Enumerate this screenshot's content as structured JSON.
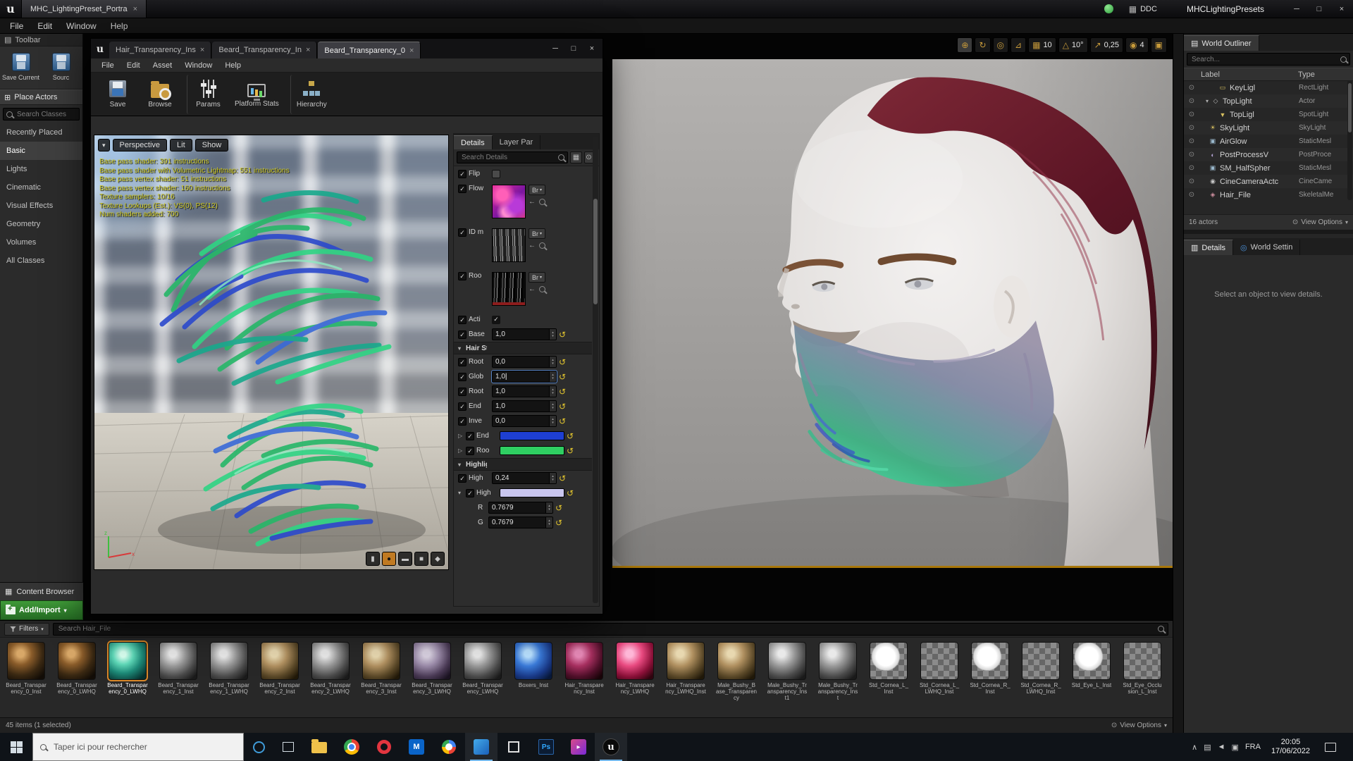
{
  "titlebar": {
    "tab_label": "MHC_LightingPreset_Portra",
    "ddc_label": "DDC",
    "preset_label": "MHCLightingPresets"
  },
  "menubar": {
    "items": [
      {
        "label": "File"
      },
      {
        "label": "Edit"
      },
      {
        "label": "Window"
      },
      {
        "label": "Help"
      }
    ]
  },
  "left_panel": {
    "toolbar_title": "Toolbar",
    "buttons": [
      {
        "label": "Save Current"
      },
      {
        "label": "Sourc"
      }
    ],
    "place_actors_title": "Place Actors",
    "search_placeholder": "Search Classes",
    "categories": [
      {
        "label": "Recently Placed"
      },
      {
        "label": "Basic",
        "selected": true
      },
      {
        "label": "Lights"
      },
      {
        "label": "Cinematic"
      },
      {
        "label": "Visual Effects"
      },
      {
        "label": "Geometry"
      },
      {
        "label": "Volumes"
      },
      {
        "label": "All Classes"
      }
    ],
    "content_browser_tab": "Content Browser",
    "add_import_label": "Add/Import"
  },
  "material_editor": {
    "tabs": [
      {
        "label": "Hair_Transparency_Ins"
      },
      {
        "label": "Beard_Transparency_In"
      },
      {
        "label": "Beard_Transparency_0",
        "active": true
      }
    ],
    "menu": [
      {
        "label": "File"
      },
      {
        "label": "Edit"
      },
      {
        "label": "Asset"
      },
      {
        "label": "Window"
      },
      {
        "label": "Help"
      }
    ],
    "toolbar": [
      {
        "label": "Save",
        "icon": "ic-save"
      },
      {
        "label": "Browse",
        "icon": "ic-browse"
      },
      {
        "label": "Params",
        "icon": "ic-params",
        "sep": true
      },
      {
        "label": "Platform Stats",
        "icon": "ic-stats"
      },
      {
        "label": "Hierarchy",
        "icon": "ic-hier",
        "sep": true
      }
    ],
    "viewport": {
      "perspective": "Perspective",
      "lit": "Lit",
      "show": "Show",
      "stats": [
        {
          "line": "Base pass shader: 391 instructions"
        },
        {
          "line": "Base pass shader with Volumetric Lightmap: 551 instructions"
        },
        {
          "line": "Base pass vertex shader: 51 instructions"
        },
        {
          "line": "Base pass vertex shader: 160 instructions"
        },
        {
          "line": "Texture samplers: 10/16"
        },
        {
          "line": "Texture Lookups (Est.): VS(0), PS(12)"
        },
        {
          "line": "Num shaders added: 700"
        }
      ]
    },
    "details": {
      "tab_details": "Details",
      "tab_layer": "Layer Par",
      "search_placeholder": "Search Details",
      "params": [
        {
          "kind": "k-check",
          "label": "Flip"
        },
        {
          "kind": "k-texture",
          "label": "Flow",
          "tex": "tex-flow",
          "btn": "Br"
        },
        {
          "kind": "k-texture",
          "label": "ID m",
          "tex": "tex-id",
          "btn": "Br"
        },
        {
          "kind": "k-texture",
          "label": "Roo",
          "tex": "tex-root",
          "btn": "Br"
        },
        {
          "kind": "k-checkval",
          "label": "Acti"
        },
        {
          "kind": "k-number",
          "label": "Base",
          "value": "1,0"
        },
        {
          "kind": "k-header",
          "label": "Hair Stra"
        },
        {
          "kind": "k-number",
          "label": "Root",
          "value": "0,0"
        },
        {
          "kind": "k-number",
          "label": "Glob",
          "value": "1,0",
          "editing": true
        },
        {
          "kind": "k-number",
          "label": "Root",
          "value": "1,0"
        },
        {
          "kind": "k-number",
          "label": "End",
          "value": "1,0"
        },
        {
          "kind": "k-number",
          "label": "Inve",
          "value": "0,0"
        },
        {
          "kind": "k-color",
          "label": "End",
          "color": "#1e3fd2",
          "expand": "exp-right"
        },
        {
          "kind": "k-color",
          "label": "Roo",
          "color": "#2fcf62",
          "expand": "exp-right"
        },
        {
          "kind": "k-header",
          "label": "Highlight"
        },
        {
          "kind": "k-number",
          "label": "High",
          "value": "0,24"
        },
        {
          "kind": "k-color",
          "label": "High",
          "color": "#c9c6ee",
          "expand": "exp-down"
        },
        {
          "kind": "k-sub",
          "label": "R",
          "value": "0.7679"
        },
        {
          "kind": "k-sub",
          "label": "G",
          "value": "0.7679"
        }
      ]
    }
  },
  "viewport_toolbar": {
    "grid_snap": "10",
    "angle_snap": "10°",
    "scale_snap": "0,25",
    "camera_speed": "4"
  },
  "world_outliner": {
    "title": "World Outliner",
    "search_placeholder": "Search...",
    "col_label": "Label",
    "col_type": "Type",
    "rows": [
      {
        "label": "KeyLigl",
        "type": "RectLight",
        "icon": "icon-rectlight",
        "indentc": "ind2"
      },
      {
        "label": "TopLight",
        "type": "Actor",
        "icon": "icon-actor",
        "indentc": "ind1",
        "arrow": "▾"
      },
      {
        "label": "TopLigl",
        "type": "SpotLight",
        "icon": "icon-spotlight",
        "indentc": "ind2"
      },
      {
        "label": "SkyLight",
        "type": "SkyLight",
        "icon": "icon-skylight",
        "indentc": "ind1"
      },
      {
        "label": "AirGlow",
        "type": "StaticMesl",
        "icon": "icon-staticmesh",
        "indentc": "ind1"
      },
      {
        "label": "PostProcessV",
        "type": "PostProce",
        "icon": "icon-postprocess",
        "indentc": "ind1"
      },
      {
        "label": "SM_HalfSpher",
        "type": "StaticMesl",
        "icon": "icon-staticmesh",
        "indentc": "ind1"
      },
      {
        "label": "CineCameraActc",
        "type": "CineCame",
        "icon": "icon-camera",
        "indentc": "ind1"
      },
      {
        "label": "Hair_File",
        "type": "SkeletalMe",
        "icon": "icon-skeletal",
        "indentc": "ind1"
      }
    ],
    "footer_count": "16 actors",
    "view_options": "View Options"
  },
  "details_panel": {
    "tab_details": "Details",
    "tab_world": "World Settin",
    "message": "Select an object to view details."
  },
  "content_browser": {
    "filters_label": "Filters",
    "search_placeholder": "Search Hair_File",
    "status": "45 items (1 selected)",
    "view_options": "View Options",
    "items": [
      {
        "name": "Beard_Transparency_0_Inst",
        "style": "th-beard-dark"
      },
      {
        "name": "Beard_Transparency_0_LWHQ",
        "style": "th-beard-dark"
      },
      {
        "name": "Beard_Transparency_0_LWHQ",
        "style": "th-beard-sel",
        "selected": true
      },
      {
        "name": "Beard_Transparency_1_Inst",
        "style": "th-gray"
      },
      {
        "name": "Beard_Transparency_1_LWHQ",
        "style": "th-gray"
      },
      {
        "name": "Beard_Transparency_2_Inst",
        "style": "th-tan"
      },
      {
        "name": "Beard_Transparency_2_LWHQ",
        "style": "th-gray"
      },
      {
        "name": "Beard_Transparency_3_Inst",
        "style": "th-tan"
      },
      {
        "name": "Beard_Transparency_3_LWHQ",
        "style": "th-purple"
      },
      {
        "name": "Beard_Transparency_LWHQ",
        "style": "th-gray"
      },
      {
        "name": "Boxers_Inst",
        "style": "th-blue"
      },
      {
        "name": "Hair_Transparency_Inst",
        "style": "th-pinkdark"
      },
      {
        "name": "Hair_Transparency_LWHQ",
        "style": "th-pink"
      },
      {
        "name": "Hair_Transparency_LWHQ_Inst",
        "style": "th-tan"
      },
      {
        "name": "Male_Bushy_Base_Transparency",
        "style": "th-tan"
      },
      {
        "name": "Male_Bushy_Transparency_Inst1",
        "style": "th-gray"
      },
      {
        "name": "Male_Bushy_Transparency_Inst",
        "style": "th-gray"
      },
      {
        "name": "Std_Cornea_L_Inst",
        "style": "th-white"
      },
      {
        "name": "Std_Cornea_L_LWHQ_Inst",
        "style": "th-checker"
      },
      {
        "name": "Std_Cornea_R_Inst",
        "style": "th-white"
      },
      {
        "name": "Std_Cornea_R_LWHQ_Inst",
        "style": "th-checker"
      },
      {
        "name": "Std_Eye_L_Inst",
        "style": "th-white"
      },
      {
        "name": "Std_Eye_Occlusion_L_Inst",
        "style": "th-checker"
      },
      {
        "name": "",
        "style": "th-checker"
      },
      {
        "name": "",
        "style": "th-white"
      },
      {
        "name": "",
        "style": "th-checker"
      }
    ]
  },
  "taskbar": {
    "search_placeholder": "Taper ici pour rechercher",
    "apps": [
      {
        "icon": "explorer-icon"
      },
      {
        "icon": "chrome-icon"
      },
      {
        "icon": "opera-icon"
      },
      {
        "icon": "mail-icon"
      },
      {
        "icon": "google-icon"
      },
      {
        "icon": "photos-icon",
        "active": true
      },
      {
        "icon": "viewer3d-icon"
      },
      {
        "icon": "photoshop-icon"
      },
      {
        "icon": "movies-icon"
      },
      {
        "icon": "unreal-icon",
        "active": true
      }
    ],
    "lang": "FRA",
    "time": "20:05",
    "date": "17/06/2022"
  }
}
